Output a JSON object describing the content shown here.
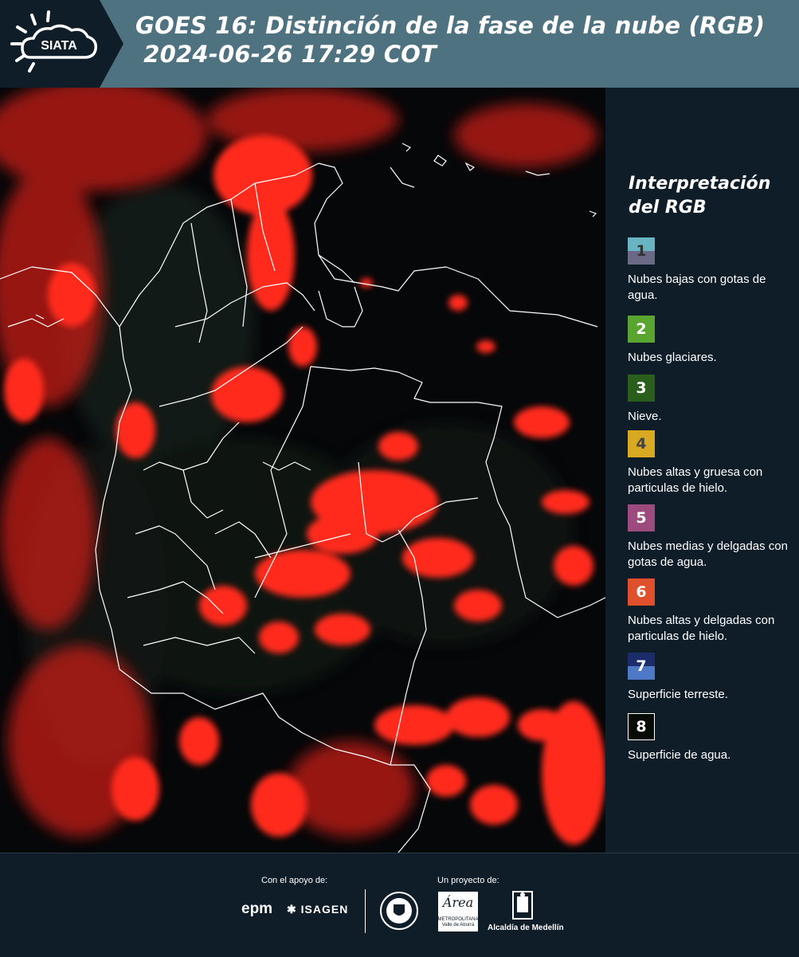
{
  "header": {
    "logo_text": "SIATA",
    "title_line1": "GOES 16: Distinción de la fase de la nube (RGB)",
    "title_line2": " 2024-06-26 17:29 COT"
  },
  "legend": {
    "title_line1": "Interpretación",
    "title_line2": "del RGB",
    "items": [
      {
        "number": "1",
        "label": "Nubes bajas con gotas de agua.",
        "color_top": "#69b4c3",
        "color_bottom": "#6b6a86"
      },
      {
        "number": "2",
        "label": "Nubes glaciares.",
        "color_top": "#5aa530",
        "color_bottom": "#5aa530"
      },
      {
        "number": "3",
        "label": "Nieve.",
        "color_top": "#295e1d",
        "color_bottom": "#295e1d"
      },
      {
        "number": "4",
        "label": "Nubes altas y gruesa con particulas de hielo.",
        "color_top": "#d9aa21",
        "color_bottom": "#d9aa21"
      },
      {
        "number": "5",
        "label": "Nubes medias y delgadas con gotas de agua.",
        "color_top": "#9d4b7e",
        "color_bottom": "#9d4b7e"
      },
      {
        "number": "6",
        "label": "Nubes altas y delgadas con particulas de hielo.",
        "color_top": "#e0502c",
        "color_bottom": "#e0502c"
      },
      {
        "number": "7",
        "label": "Superficie terreste.",
        "color_top": "#1b2c6a",
        "color_bottom": "#4f78c7"
      },
      {
        "number": "8",
        "label": "Superficie de agua.",
        "color_top": "#060b06",
        "color_bottom": "#060b06"
      }
    ]
  },
  "footer": {
    "support_label": "Con el apoyo de:",
    "project_label": "Un proyecto de:",
    "sponsor1": "epm",
    "sponsor2": "ISAGEN",
    "partner_area": "Área",
    "partner_area_sub": "METROPOLITANA Valle de Aburrá",
    "partner_city": "Alcaldía de Medellín"
  },
  "colors": {
    "header_bg": "#4f7280",
    "panel_bg": "#0e1d28",
    "cloud_red": "#ff2a1a"
  }
}
